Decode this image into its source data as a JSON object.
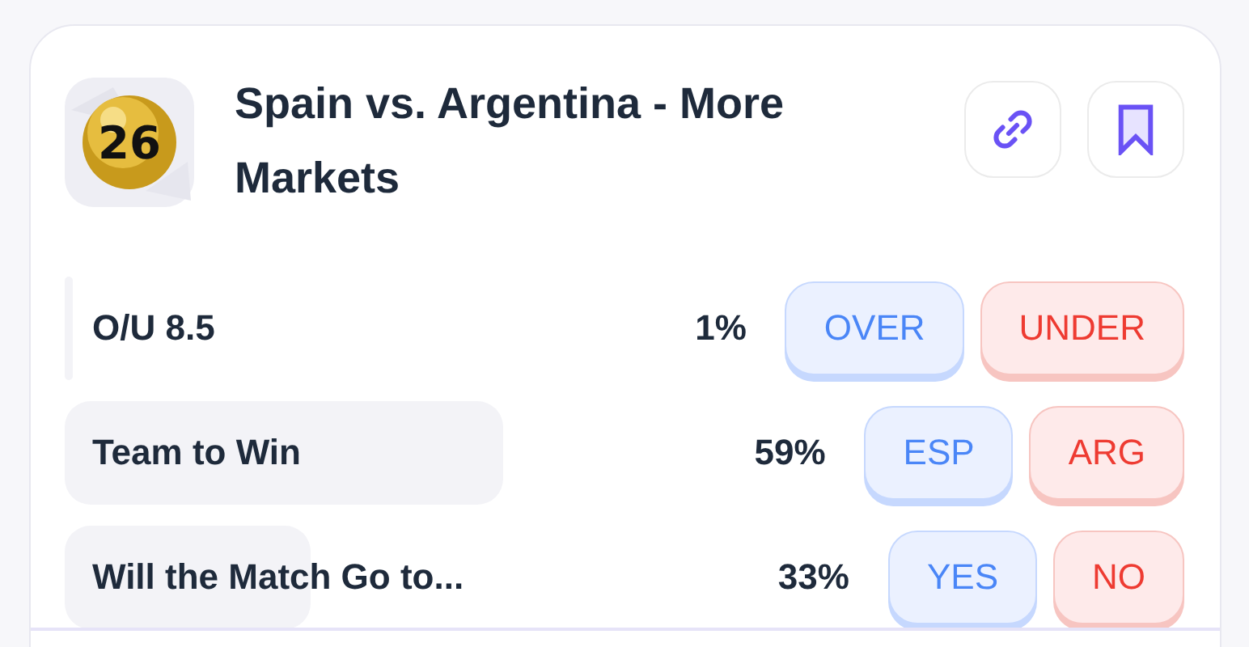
{
  "header": {
    "logo_text": "26",
    "title": "Spain vs. Argentina - More Markets"
  },
  "markets": [
    {
      "label": "O/U 8.5",
      "percent": "1%",
      "options": [
        {
          "label": "OVER",
          "kind": "yes"
        },
        {
          "label": "UNDER",
          "kind": "no"
        }
      ]
    },
    {
      "label": "Team to Win",
      "percent": "59%",
      "options": [
        {
          "label": "ESP",
          "kind": "yes"
        },
        {
          "label": "ARG",
          "kind": "no"
        }
      ]
    },
    {
      "label": "Will the Match Go to...",
      "percent": "33%",
      "options": [
        {
          "label": "YES",
          "kind": "yes"
        },
        {
          "label": "NO",
          "kind": "no"
        }
      ]
    }
  ]
}
